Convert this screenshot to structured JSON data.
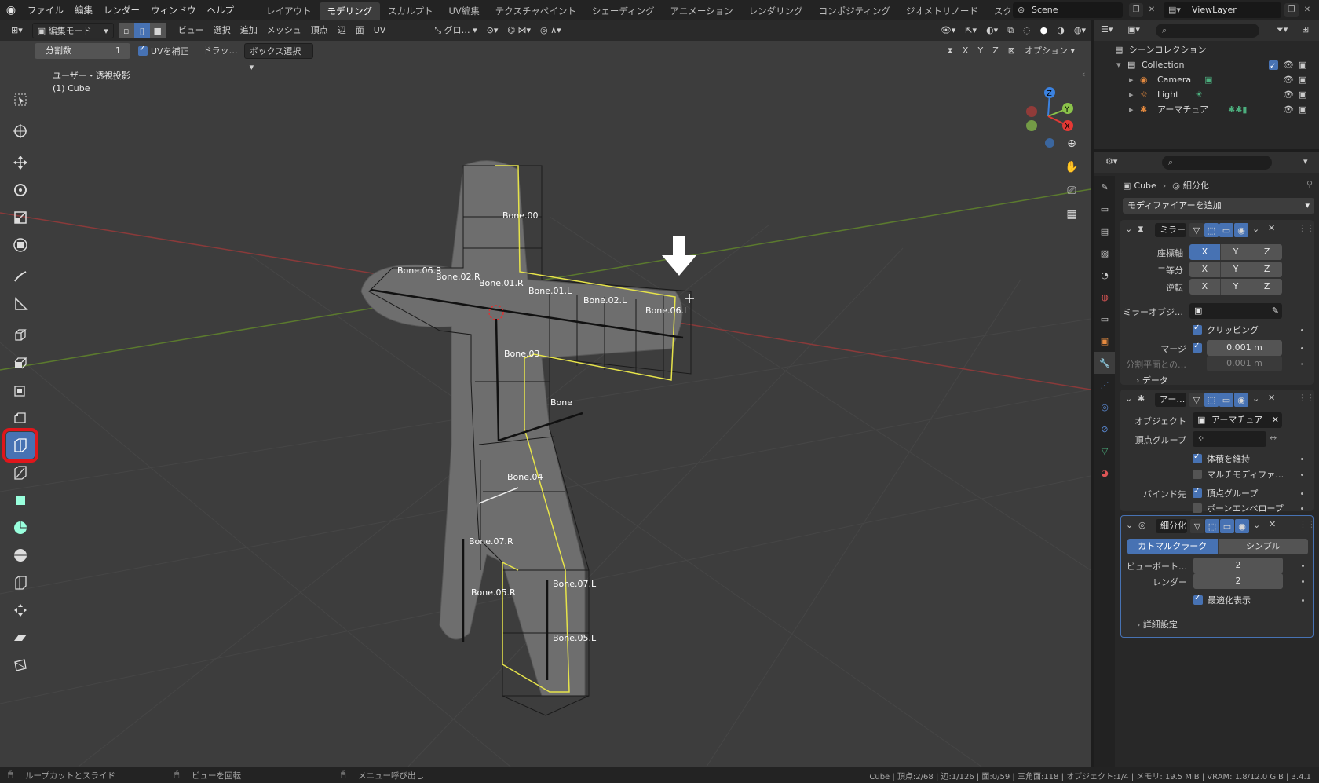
{
  "menu": {
    "items": [
      "ファイル",
      "編集",
      "レンダー",
      "ウィンドウ",
      "ヘルプ"
    ]
  },
  "workspaces": {
    "tabs": [
      "レイアウト",
      "モデリング",
      "スカルプト",
      "UV編集",
      "テクスチャペイント",
      "シェーディング",
      "アニメーション",
      "レンダリング",
      "コンポジティング",
      "ジオメトリノード",
      "スクリプト"
    ],
    "active_index": 1
  },
  "scene": {
    "name": "Scene"
  },
  "view_layer": {
    "name": "ViewLayer"
  },
  "viewport": {
    "mode": "編集モード",
    "menus": [
      "ビュー",
      "選択",
      "追加",
      "メッシュ",
      "頂点",
      "辺",
      "面",
      "UV"
    ],
    "transform_orientation": "グロ…",
    "tool_settings": {
      "cuts_label": "分割数",
      "cuts_value": "1",
      "uv_correct": "UVを補正",
      "drag": "ドラッ…",
      "select_mode": "ボックス選択"
    },
    "axis_x": "X",
    "axis_y": "Y",
    "axis_z": "Z",
    "options": "オプション",
    "view_name": "ユーザー・透視投影",
    "object_info": "(1) Cube",
    "bones": [
      "Bone.00",
      "Bone.06.R",
      "Bone.02.R",
      "Bone.01.R",
      "Bone.01.L",
      "Bone.02.L",
      "Bone.06.L",
      "Bone.03",
      "Bone",
      "Bone.04",
      "Bone.07.R",
      "Bone.05.R",
      "Bone.07.L",
      "Bone.05.L"
    ]
  },
  "toolbar": {
    "tools": [
      "select-box-tool",
      "cursor-tool",
      "move-tool",
      "rotate-tool",
      "scale-tool",
      "transform-tool",
      "annotate-tool",
      "measure-tool",
      "add-cube-tool",
      "extrude-tool",
      "inset-tool",
      "bevel-tool",
      "loop-cut-tool",
      "knife-tool",
      "poly-build-tool",
      "spin-tool",
      "smooth-tool",
      "edge-slide-tool",
      "shrink-tool",
      "shear-tool",
      "rip-tool"
    ],
    "active_tool": "loop-cut-tool"
  },
  "outliner": {
    "root": "シーンコレクション",
    "collection": "Collection",
    "items": [
      "Camera",
      "Light",
      "アーマチュア"
    ]
  },
  "properties": {
    "breadcrumb_object": "Cube",
    "breadcrumb_modifier": "細分化",
    "add_modifier": "モディファイアーを追加",
    "mirror": {
      "name": "ミラー",
      "axis_label": "座標軸",
      "bisect_label": "二等分",
      "flip_label": "逆転",
      "mirror_object_label": "ミラーオブジ…",
      "clipping": "クリッピング",
      "merge_label": "マージ",
      "merge_value": "0.001 m",
      "bisect_distance_label": "分割平面との…",
      "bisect_distance_value": "0.001 m",
      "data": "データ"
    },
    "armature": {
      "name": "アー…",
      "object_label": "オブジェクト",
      "object_value": "アーマチュア",
      "vgroup_label": "頂点グループ",
      "preserve_volume": "体積を維持",
      "multi_modifier": "マルチモディファ…",
      "bind_to_label": "バインド先",
      "vertex_groups": "頂点グループ",
      "bone_envelopes": "ボーンエンベロープ"
    },
    "subsurf": {
      "name": "細分化",
      "catmull": "カトマルクラーク",
      "simple": "シンプル",
      "viewport_label": "ビューポート…",
      "viewport_value": "2",
      "render_label": "レンダー",
      "render_value": "2",
      "optimal_display": "最適化表示",
      "advanced": "詳細設定"
    }
  },
  "statusbar": {
    "left1": "ループカットとスライド",
    "left2": "ビューを回転",
    "left3": "メニュー呼び出し",
    "stats": "Cube | 頂点:2/68 | 辺:1/126 | 面:0/59 | 三角面:118 | オブジェクト:1/4 | メモリ: 19.5 MiB | VRAM: 1.8/12.0 GiB | 3.4.1"
  },
  "colors": {
    "accent": "#4772b3",
    "highlight": "#e0161b",
    "viewport_bg": "#3d3d3d",
    "selected_edge": "#e6e34a"
  }
}
